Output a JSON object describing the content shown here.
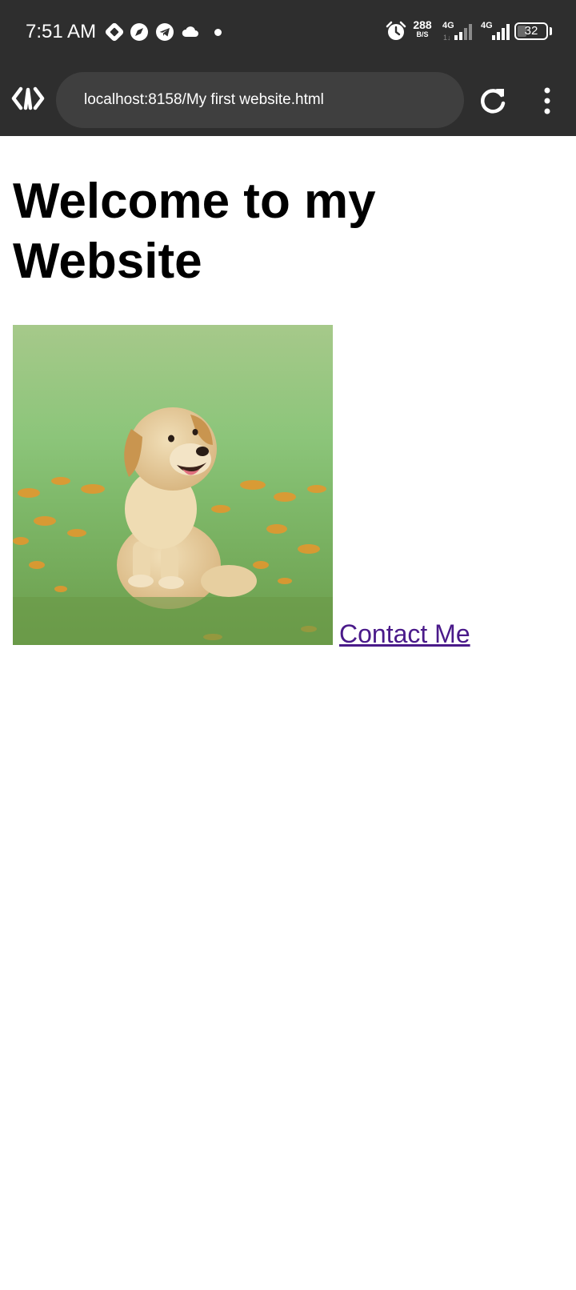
{
  "status_bar": {
    "time": "7:51 AM",
    "net_speed_value": "288",
    "net_speed_unit": "B/S",
    "sim1_type": "4G",
    "sim2_type": "4G",
    "battery_level": "32",
    "battery_fraction": 0.32,
    "icons": [
      "autosync-icon",
      "compass-icon",
      "telegram-icon",
      "cloud-icon",
      "notification-dot-icon",
      "alarm-icon",
      "signal-icon",
      "signal-icon",
      "battery-icon"
    ]
  },
  "browser": {
    "url": "localhost:8158/My first website.html",
    "logo_icon": "code-brackets-icon",
    "reload_icon": "reload-icon",
    "menu_icon": "more-vertical-icon"
  },
  "page": {
    "title": "Welcome to my Website",
    "image_subject": "puppy-image",
    "contact_link": "Contact Me"
  },
  "colors": {
    "toolbar_bg": "#2e2e2e",
    "url_bg": "#3f3f3f",
    "link_visited": "#4a1a8a"
  }
}
